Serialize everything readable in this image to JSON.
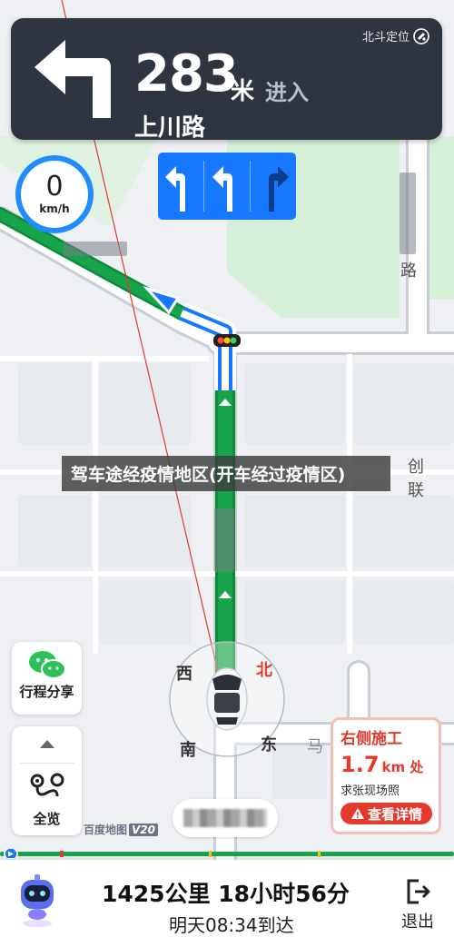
{
  "banner": {
    "distance": "283",
    "unit": "米",
    "action": "进入",
    "road": "上川路",
    "beidou_label": "北斗定位",
    "turn_icon": "turn-left-arrow"
  },
  "lanes": [
    "left-arrow",
    "left-arrow",
    "right-arrow"
  ],
  "speed": {
    "value": "0",
    "unit": "km/h"
  },
  "map_labels": {
    "road_right_upper": "路",
    "road_right_mid": "创 联",
    "road_bottom_right": "马"
  },
  "overlay_caption": "驾车途经疫情地区(开车经过疫情区)",
  "side_buttons": {
    "share_label": "行程分享",
    "overview_label": "全览"
  },
  "compass": {
    "west": "西",
    "north": "北",
    "south": "南",
    "east": "东"
  },
  "warning": {
    "title": "右侧施工",
    "distance": "1.7",
    "distance_unit": "km 处",
    "subtitle": "求张现场照",
    "button_label": "查看详情"
  },
  "map_logo": {
    "text": "百度地图",
    "version": "V20"
  },
  "trip": {
    "summary": "1425公里  18小时56分",
    "eta": "明天08:34到达",
    "exit_label": "退出"
  },
  "colors": {
    "route_green": "#17a44b",
    "lane_blue": "#1677ff",
    "banner_bg": "#2f3540",
    "warning_red": "#e23b2e"
  }
}
